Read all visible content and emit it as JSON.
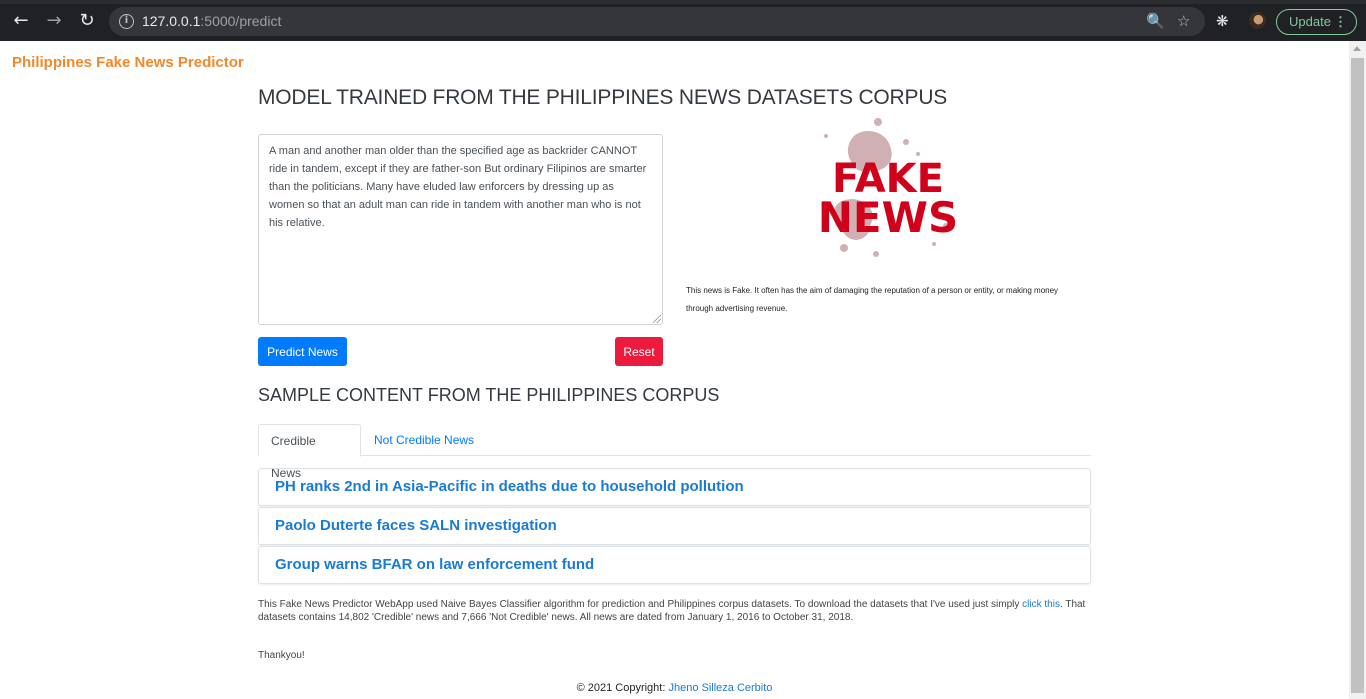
{
  "browser": {
    "url_host": "127.0.0.1",
    "url_path": ":5000/predict",
    "update_label": "Update"
  },
  "navbar": {
    "brand": "Philippines Fake News Predictor"
  },
  "main": {
    "heading": "MODEL TRAINED FROM THE PHILIPPINES NEWS DATASETS CORPUS",
    "input_value": "A man and another man older than the specified age as backrider CANNOT ride in tandem, except if they are father-son But ordinary Filipinos are smarter than the politicians. Many have eluded law enforcers by dressing up as women so that an adult man can ride in tandem with another man who is not his relative.",
    "predict_label": "Predict News",
    "reset_label": "Reset",
    "result_image": {
      "line1": "FAKE",
      "line2": "NEWS",
      "color": "#d0021b"
    },
    "result_text": "This news is Fake. It often has the aim of damaging the reputation of a person or entity, or making money through advertising revenue."
  },
  "samples": {
    "heading": "SAMPLE CONTENT FROM THE PHILIPPINES CORPUS",
    "tabs": [
      {
        "label": "Credible News"
      },
      {
        "label": "Not Credible News"
      }
    ],
    "items": [
      {
        "title": "PH ranks 2nd in Asia-Pacific in deaths due to household pollution"
      },
      {
        "title": "Paolo Duterte faces SALN investigation"
      },
      {
        "title": "Group warns BFAR on law enforcement fund"
      }
    ]
  },
  "footer": {
    "text_before": "This Fake News Predictor WebApp used Naive Bayes Classifier algorithm for prediction and Philippines corpus datasets. To download the datasets that I've used just simply ",
    "link": "click this",
    "text_after": ". That datasets contains 14,802 'Credible' news and 7,666 'Not Credible' news. All news are dated from January 1, 2016 to October 31, 2018.",
    "thanks": "Thankyou!",
    "copyright_prefix": "© 2021 Copyright: ",
    "author": "Jheno Silleza Cerbito"
  }
}
